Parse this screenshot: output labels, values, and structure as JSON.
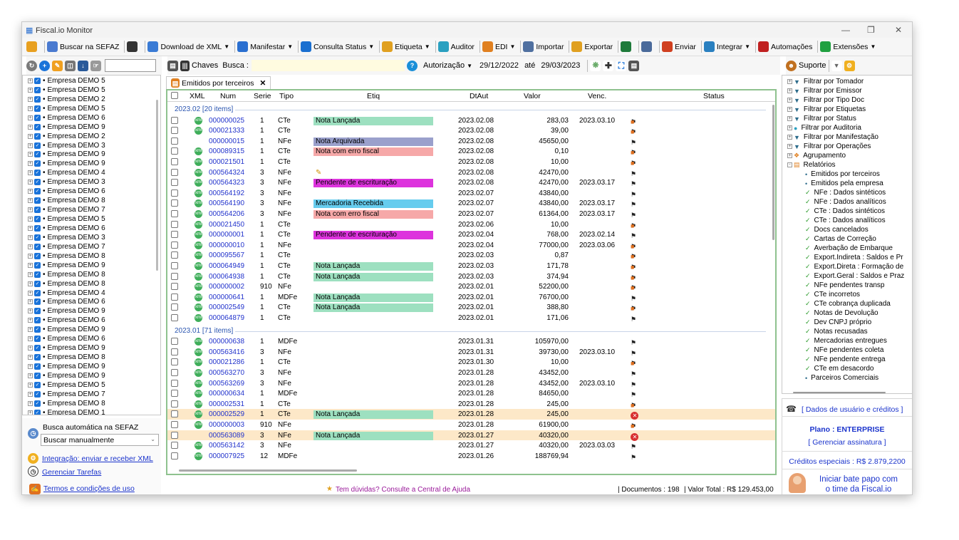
{
  "window": {
    "title": "Fiscal.io Monitor"
  },
  "toolbar": [
    {
      "icon": "sun-icon",
      "label": "",
      "color": "#e8a020"
    },
    {
      "icon": "cloud-search-icon",
      "label": "Buscar na SEFAZ",
      "color": "#4a7ad0"
    },
    {
      "icon": "list-icon",
      "label": "",
      "color": "#333333"
    },
    {
      "icon": "xml-icon",
      "label": "Download de XML",
      "color": "#3a7bd5",
      "dd": true
    },
    {
      "icon": "manifest-icon",
      "label": "Manifestar",
      "color": "#2a6fd0",
      "dd": true
    },
    {
      "icon": "status-check-icon",
      "label": "Consulta Status",
      "color": "#1a6fd0",
      "dd": true
    },
    {
      "icon": "tag-icon",
      "label": "Etiqueta",
      "color": "#e0a020",
      "dd": true
    },
    {
      "icon": "auditor-icon",
      "label": "Auditor",
      "color": "#2aa0c0"
    },
    {
      "icon": "truck-icon",
      "label": "EDI",
      "color": "#e08020",
      "dd": true
    },
    {
      "icon": "import-icon",
      "label": "Importar",
      "color": "#5070a0"
    },
    {
      "icon": "export-icon",
      "label": "Exportar",
      "color": "#e0a020"
    },
    {
      "icon": "excel-icon",
      "label": "",
      "color": "#1e7a3a"
    },
    {
      "icon": "printer-icon",
      "label": "",
      "color": "#4a6a9a"
    },
    {
      "icon": "mail-icon",
      "label": "Enviar",
      "color": "#d04020"
    },
    {
      "icon": "integrate-icon",
      "label": "Integrar",
      "color": "#2a80c0",
      "dd": true
    },
    {
      "icon": "automation-icon",
      "label": "Automações",
      "color": "#c02020"
    },
    {
      "icon": "extensions-icon",
      "label": "Extensões",
      "color": "#20a040",
      "dd": true
    }
  ],
  "filterbar": {
    "chaves": "Chaves",
    "busca": "Busca :",
    "autorizacao": "Autorização",
    "date_from": "29/12/2022",
    "ate": "até",
    "date_to": "29/03/2023"
  },
  "companies": [
    "Empresa DEMO 5",
    "Empresa DEMO 5",
    "Empresa DEMO 2",
    "Empresa DEMO 5",
    "Empresa DEMO 6",
    "Empresa DEMO 9",
    "Empresa DEMO 2",
    "Empresa DEMO 3",
    "Empresa DEMO 9",
    "Empresa DEMO 9",
    "Empresa DEMO 4",
    "Empresa DEMO 3",
    "Empresa DEMO 6",
    "Empresa DEMO 8",
    "Empresa DEMO 7",
    "Empresa DEMO 5",
    "Empresa DEMO 6",
    "Empresa DEMO 3",
    "Empresa DEMO 7",
    "Empresa DEMO 8",
    "Empresa DEMO 9",
    "Empresa DEMO 8",
    "Empresa DEMO 8",
    "Empresa DEMO 4",
    "Empresa DEMO 6",
    "Empresa DEMO 9",
    "Empresa DEMO 6",
    "Empresa DEMO 9",
    "Empresa DEMO 6",
    "Empresa DEMO 9",
    "Empresa DEMO 8",
    "Empresa DEMO 9",
    "Empresa DEMO 9",
    "Empresa DEMO 5",
    "Empresa DEMO 7",
    "Empresa DEMO 8",
    "Empresa DEMO 1"
  ],
  "left_bottom": {
    "busca_label": "Busca automática na SEFAZ",
    "busca_value": "Buscar manualmente",
    "integracao": "Integração: enviar e receber XML",
    "tarefas": "Gerenciar Tarefas",
    "termos": "Termos e condições de uso"
  },
  "tab": {
    "label": "Emitidos por terceiros"
  },
  "columns": [
    "XML",
    "Num",
    "Serie",
    "Tipo",
    "Etiq",
    "DtAut",
    "Valor",
    "Venc.",
    "Status"
  ],
  "groups": [
    {
      "label": "2023.02 [20 items]",
      "rows": [
        {
          "xml": true,
          "num": "000000025",
          "serie": "1",
          "tipo": "CTe",
          "etiq": "Nota Lançada",
          "etiq_color": "#9de0c0",
          "dt": "2023.02.08",
          "valor": "283,03",
          "venc": "2023.03.10",
          "status": "flag-truck"
        },
        {
          "xml": true,
          "num": "000021333",
          "serie": "1",
          "tipo": "CTe",
          "etiq": "",
          "etiq_color": "",
          "dt": "2023.02.08",
          "valor": "39,00",
          "venc": "",
          "status": "flag-truck"
        },
        {
          "xml": false,
          "num": "000000015",
          "serie": "1",
          "tipo": "NFe",
          "etiq": "Nota Arquivada",
          "etiq_color": "#9aa0cc",
          "dt": "2023.02.08",
          "valor": "45650,00",
          "venc": "",
          "status": "flag"
        },
        {
          "xml": true,
          "num": "000089315",
          "serie": "1",
          "tipo": "CTe",
          "etiq": "Nota com erro fiscal",
          "etiq_color": "#f6a8a8",
          "dt": "2023.02.08",
          "valor": "0,10",
          "venc": "",
          "status": "flag-truck"
        },
        {
          "xml": true,
          "num": "000021501",
          "serie": "1",
          "tipo": "CTe",
          "etiq": "",
          "etiq_color": "",
          "dt": "2023.02.08",
          "valor": "10,00",
          "venc": "",
          "status": "flag-truck"
        },
        {
          "xml": true,
          "num": "000564324",
          "serie": "3",
          "tipo": "NFe",
          "etiq": "✎",
          "etiq_color": "",
          "dt": "2023.02.08",
          "valor": "42470,00",
          "venc": "",
          "status": "flag"
        },
        {
          "xml": true,
          "num": "000564323",
          "serie": "3",
          "tipo": "NFe",
          "etiq": "Pendente de escrituração",
          "etiq_color": "#dd33dd",
          "dt": "2023.02.08",
          "valor": "42470,00",
          "venc": "2023.03.17",
          "status": "flag"
        },
        {
          "xml": true,
          "num": "000564192",
          "serie": "3",
          "tipo": "NFe",
          "etiq": "",
          "etiq_color": "",
          "dt": "2023.02.07",
          "valor": "43840,00",
          "venc": "",
          "status": "flag"
        },
        {
          "xml": true,
          "num": "000564190",
          "serie": "3",
          "tipo": "NFe",
          "etiq": "Mercadoria Recebida",
          "etiq_color": "#66ccee",
          "dt": "2023.02.07",
          "valor": "43840,00",
          "venc": "2023.03.17",
          "status": "flag"
        },
        {
          "xml": true,
          "num": "000564206",
          "serie": "3",
          "tipo": "NFe",
          "etiq": "Nota com erro fiscal",
          "etiq_color": "#f6a8a8",
          "dt": "2023.02.07",
          "valor": "61364,00",
          "venc": "2023.03.17",
          "status": "flag"
        },
        {
          "xml": true,
          "num": "000021450",
          "serie": "1",
          "tipo": "CTe",
          "etiq": "",
          "etiq_color": "",
          "dt": "2023.02.06",
          "valor": "10,00",
          "venc": "",
          "status": "flag-truck"
        },
        {
          "xml": true,
          "num": "000000001",
          "serie": "1",
          "tipo": "CTe",
          "etiq": "Pendente de escrituração",
          "etiq_color": "#dd33dd",
          "dt": "2023.02.04",
          "valor": "768,00",
          "venc": "2023.02.14",
          "status": "flag"
        },
        {
          "xml": true,
          "num": "000000010",
          "serie": "1",
          "tipo": "NFe",
          "etiq": "",
          "etiq_color": "",
          "dt": "2023.02.04",
          "valor": "77000,00",
          "venc": "2023.03.06",
          "status": "flag-truck"
        },
        {
          "xml": true,
          "num": "000095567",
          "serie": "1",
          "tipo": "CTe",
          "etiq": "",
          "etiq_color": "",
          "dt": "2023.02.03",
          "valor": "0,87",
          "venc": "",
          "status": "flag-truck"
        },
        {
          "xml": true,
          "num": "000064949",
          "serie": "1",
          "tipo": "CTe",
          "etiq": "Nota Lançada",
          "etiq_color": "#9de0c0",
          "dt": "2023.02.03",
          "valor": "171,78",
          "venc": "",
          "status": "flag-truck"
        },
        {
          "xml": true,
          "num": "000064938",
          "serie": "1",
          "tipo": "CTe",
          "etiq": "Nota Lançada",
          "etiq_color": "#9de0c0",
          "dt": "2023.02.03",
          "valor": "374,94",
          "venc": "",
          "status": "flag-truck"
        },
        {
          "xml": true,
          "num": "000000002",
          "serie": "910",
          "tipo": "NFe",
          "etiq": "",
          "etiq_color": "",
          "dt": "2023.02.01",
          "valor": "52200,00",
          "venc": "",
          "status": "flag-truck-truck"
        },
        {
          "xml": true,
          "num": "000000641",
          "serie": "1",
          "tipo": "MDFe",
          "etiq": "Nota Lançada",
          "etiq_color": "#9de0c0",
          "dt": "2023.02.01",
          "valor": "76700,00",
          "venc": "",
          "status": "flag"
        },
        {
          "xml": true,
          "num": "000002549",
          "serie": "1",
          "tipo": "CTe",
          "etiq": "Nota Lançada",
          "etiq_color": "#9de0c0",
          "dt": "2023.02.01",
          "valor": "388,80",
          "venc": "",
          "status": "flag-truck"
        },
        {
          "xml": true,
          "num": "000064879",
          "serie": "1",
          "tipo": "CTe",
          "etiq": "",
          "etiq_color": "",
          "dt": "2023.02.01",
          "valor": "171,06",
          "venc": "",
          "status": "flag"
        }
      ]
    },
    {
      "label": "2023.01 [71 items]",
      "rows": [
        {
          "xml": true,
          "num": "000000638",
          "serie": "1",
          "tipo": "MDFe",
          "etiq": "",
          "etiq_color": "",
          "dt": "2023.01.31",
          "valor": "105970,00",
          "venc": "",
          "status": "flag"
        },
        {
          "xml": true,
          "num": "000563416",
          "serie": "3",
          "tipo": "NFe",
          "etiq": "",
          "etiq_color": "",
          "dt": "2023.01.31",
          "valor": "39730,00",
          "venc": "2023.03.10",
          "status": "flag"
        },
        {
          "xml": true,
          "num": "000021286",
          "serie": "1",
          "tipo": "CTe",
          "etiq": "",
          "etiq_color": "",
          "dt": "2023.01.30",
          "valor": "10,00",
          "venc": "",
          "status": "flag-truck"
        },
        {
          "xml": true,
          "num": "000563270",
          "serie": "3",
          "tipo": "NFe",
          "etiq": "",
          "etiq_color": "",
          "dt": "2023.01.28",
          "valor": "43452,00",
          "venc": "",
          "status": "flag"
        },
        {
          "xml": true,
          "num": "000563269",
          "serie": "3",
          "tipo": "NFe",
          "etiq": "",
          "etiq_color": "",
          "dt": "2023.01.28",
          "valor": "43452,00",
          "venc": "2023.03.10",
          "status": "flag"
        },
        {
          "xml": true,
          "num": "000000634",
          "serie": "1",
          "tipo": "MDFe",
          "etiq": "",
          "etiq_color": "",
          "dt": "2023.01.28",
          "valor": "84650,00",
          "venc": "",
          "status": "flag"
        },
        {
          "xml": true,
          "num": "000002531",
          "serie": "1",
          "tipo": "CTe",
          "etiq": "",
          "etiq_color": "",
          "dt": "2023.01.28",
          "valor": "245,00",
          "venc": "",
          "status": "flag-truck"
        },
        {
          "xml": true,
          "num": "000002529",
          "serie": "1",
          "tipo": "CTe",
          "etiq": "Nota Lançada",
          "etiq_color": "#9de0c0",
          "dt": "2023.01.28",
          "valor": "245,00",
          "venc": "",
          "status": "cancel",
          "hl": true
        },
        {
          "xml": true,
          "num": "000000003",
          "serie": "910",
          "tipo": "NFe",
          "etiq": "",
          "etiq_color": "",
          "dt": "2023.01.28",
          "valor": "61900,00",
          "venc": "",
          "status": "flag-truck-truck"
        },
        {
          "xml": false,
          "num": "000563089",
          "serie": "3",
          "tipo": "NFe",
          "etiq": "Nota Lançada",
          "etiq_color": "#9de0c0",
          "dt": "2023.01.27",
          "valor": "40320,00",
          "venc": "",
          "status": "cancel",
          "hl": true
        },
        {
          "xml": true,
          "num": "000563142",
          "serie": "3",
          "tipo": "NFe",
          "etiq": "",
          "etiq_color": "",
          "dt": "2023.01.27",
          "valor": "40320,00",
          "venc": "2023.03.03",
          "status": "flag"
        },
        {
          "xml": true,
          "num": "000007925",
          "serie": "12",
          "tipo": "MDFe",
          "etiq": "",
          "etiq_color": "",
          "dt": "2023.01.26",
          "valor": "188769,94",
          "venc": "",
          "status": "flag"
        }
      ]
    }
  ],
  "status_bar": {
    "help": "Tem dúvidas? Consulte a Central de Ajuda",
    "docs": "| Documentos : 198",
    "total": "|  Valor Total : R$ 129.453,00"
  },
  "right_toolbar": {
    "suporte": "Suporte"
  },
  "right_tree": [
    {
      "label": "Filtrar por Tomador",
      "kind": "filter"
    },
    {
      "label": "Filtrar por Emissor",
      "kind": "filter"
    },
    {
      "label": "Filtrar por Tipo Doc",
      "kind": "filter"
    },
    {
      "label": "Filtrar por Etiquetas",
      "kind": "filter"
    },
    {
      "label": "Filtrar por Status",
      "kind": "filter"
    },
    {
      "label": "Filtrar por Auditoria",
      "kind": "audit"
    },
    {
      "label": "Filtrar por Manifestação",
      "kind": "filter"
    },
    {
      "label": "Filtrar por Operações",
      "kind": "filter"
    },
    {
      "label": "Agrupamento",
      "kind": "group"
    },
    {
      "label": "Relatórios",
      "kind": "report"
    },
    {
      "label": "Emitidos por terceiros",
      "kind": "dot"
    },
    {
      "label": "Emitidos pela empresa",
      "kind": "dot"
    },
    {
      "label": "NFe : Dados sintéticos",
      "kind": "check"
    },
    {
      "label": "NFe : Dados analíticos",
      "kind": "check"
    },
    {
      "label": "CTe : Dados sintéticos",
      "kind": "check"
    },
    {
      "label": "CTe : Dados analíticos",
      "kind": "check"
    },
    {
      "label": "Docs cancelados",
      "kind": "check"
    },
    {
      "label": "Cartas de Correção",
      "kind": "check"
    },
    {
      "label": "Averbação de Embarque",
      "kind": "check"
    },
    {
      "label": "Export.Indireta : Saldos e Pr",
      "kind": "check"
    },
    {
      "label": "Export.Direta : Formação de",
      "kind": "check"
    },
    {
      "label": "Export.Geral : Saldos e Praz",
      "kind": "check"
    },
    {
      "label": "NFe pendentes transp",
      "kind": "check"
    },
    {
      "label": "CTe incorretos",
      "kind": "check"
    },
    {
      "label": "CTe cobrança duplicada",
      "kind": "check"
    },
    {
      "label": "Notas de Devolução",
      "kind": "check"
    },
    {
      "label": "Dev CNPJ próprio",
      "kind": "check"
    },
    {
      "label": "Notas recusadas",
      "kind": "check"
    },
    {
      "label": "Mercadorias entregues",
      "kind": "check"
    },
    {
      "label": "NFe pendentes coleta",
      "kind": "check"
    },
    {
      "label": "NFe pendente entrega",
      "kind": "check"
    },
    {
      "label": "CTe em desacordo",
      "kind": "check"
    },
    {
      "label": "Parceiros Comerciais",
      "kind": "dot"
    }
  ],
  "right_bottom": {
    "dados": "[ Dados de usuário e créditos ]",
    "plano": "Plano : ENTERPRISE",
    "gerenciar": "[ Gerenciar assinatura ]",
    "creditos": "Créditos especiais : R$ 2.879,2200",
    "chat1": "Iniciar bate papo com",
    "chat2": "o time da Fiscal.io"
  },
  "colors": {
    "accent": "#1a33cc",
    "grid_border": "#8fc28f",
    "highlight_row": "#fde8c8",
    "link": "#2233cc"
  }
}
